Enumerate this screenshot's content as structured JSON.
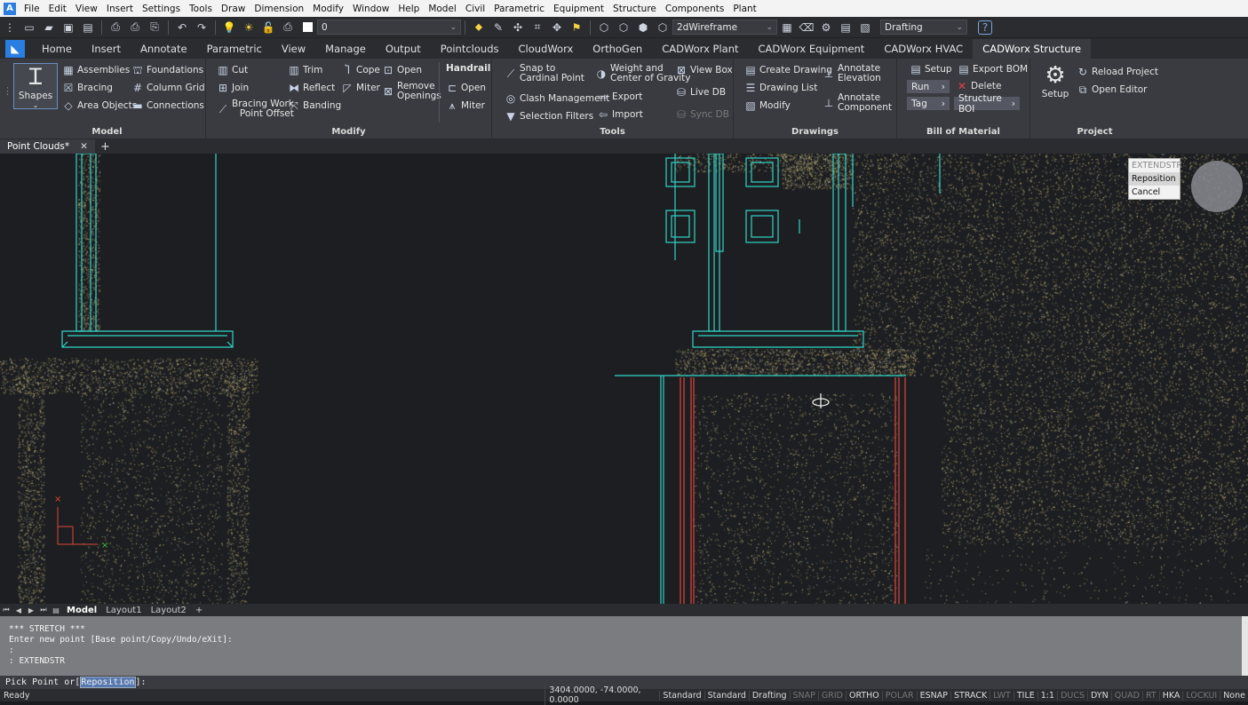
{
  "menubar": {
    "items": [
      "File",
      "Edit",
      "View",
      "Insert",
      "Settings",
      "Tools",
      "Draw",
      "Dimension",
      "Modify",
      "Window",
      "Help",
      "Model",
      "Civil",
      "Parametric",
      "Equipment",
      "Structure",
      "Components",
      "Plant"
    ]
  },
  "qat": {
    "layer_value": "0",
    "visual_style": "2dWireframe",
    "workspace": "Drafting"
  },
  "ribbon_tabs": [
    "Home",
    "Insert",
    "Annotate",
    "Parametric",
    "View",
    "Manage",
    "Output",
    "Pointclouds",
    "CloudWorx",
    "OrthoGen",
    "CADWorx Plant",
    "CADWorx Equipment",
    "CADWorx HVAC",
    "CADWorx Structure"
  ],
  "active_tab": "CADWorx Structure",
  "panels": {
    "model": {
      "title": "Model",
      "shapes": "Shapes",
      "assemblies": "Assemblies",
      "foundations": "Foundations",
      "bracing": "Bracing",
      "column_grid": "Column Grid",
      "area_objects": "Area Objects",
      "connections": "Connections"
    },
    "modify": {
      "title": "Modify",
      "cut": "Cut",
      "trim": "Trim",
      "cope": "Cope",
      "open": "Open",
      "join": "Join",
      "reflect": "Reflect",
      "miter": "Miter",
      "remove_openings_1": "Remove",
      "remove_openings_2": "Openings",
      "bracing_work_1": "Bracing Work",
      "bracing_work_2": "Point Offset",
      "banding": "Banding",
      "handrail": "Handrail",
      "handrail_open": "Open",
      "handrail_miter": "Miter"
    },
    "tools": {
      "title": "Tools",
      "snap_1": "Snap to",
      "snap_2": "Cardinal Point",
      "clash": "Clash Management",
      "selection": "Selection Filters",
      "weight_1": "Weight and",
      "weight_2": "Center of Gravity",
      "export": "Export",
      "import": "Import",
      "view_box": "View Box",
      "live_db": "Live DB",
      "sync_db": "Sync DB"
    },
    "drawings": {
      "title": "Drawings",
      "create": "Create Drawing",
      "list": "Drawing List",
      "modify": "Modify",
      "annotate_elev_1": "Annotate",
      "annotate_elev_2": "Elevation",
      "annotate_comp_1": "Annotate",
      "annotate_comp_2": "Component"
    },
    "bom": {
      "title": "Bill of Material",
      "setup": "Setup",
      "export_bom": "Export BOM",
      "run": "Run",
      "delete": "Delete",
      "tag": "Tag",
      "structure_bom": "Structure BOI"
    },
    "project": {
      "title": "Project",
      "setup": "Setup",
      "reload": "Reload Project",
      "open_editor": "Open Editor"
    }
  },
  "doc_tab": {
    "label": "Point Clouds*"
  },
  "context_menu": {
    "header": "EXTENDSTR",
    "items": [
      "Reposition",
      "Cancel"
    ]
  },
  "layouts": [
    "Model",
    "Layout1",
    "Layout2"
  ],
  "command_history": [
    "*** STRETCH ***",
    "Enter new point [Base point/Copy/Undo/eXit]:",
    ":",
    ": EXTENDSTR"
  ],
  "command_line": {
    "prompt": "Pick Point or[",
    "option": "Reposition",
    "suffix": "]:"
  },
  "status": {
    "ready": "Ready",
    "coords": "3404.0000, -74.0000, 0.0000",
    "items": [
      "Standard",
      "Standard",
      "Drafting",
      "SNAP",
      "GRID",
      "ORTHO",
      "POLAR",
      "ESNAP",
      "STRACK",
      "LWT",
      "TILE",
      "1:1",
      "DUCS",
      "DYN",
      "QUAD",
      "RT",
      "HKA",
      "LOCKUI",
      "None"
    ],
    "off": [
      "SNAP",
      "GRID",
      "POLAR",
      "LWT",
      "DUCS",
      "QUAD",
      "RT",
      "LOCKUI"
    ]
  }
}
